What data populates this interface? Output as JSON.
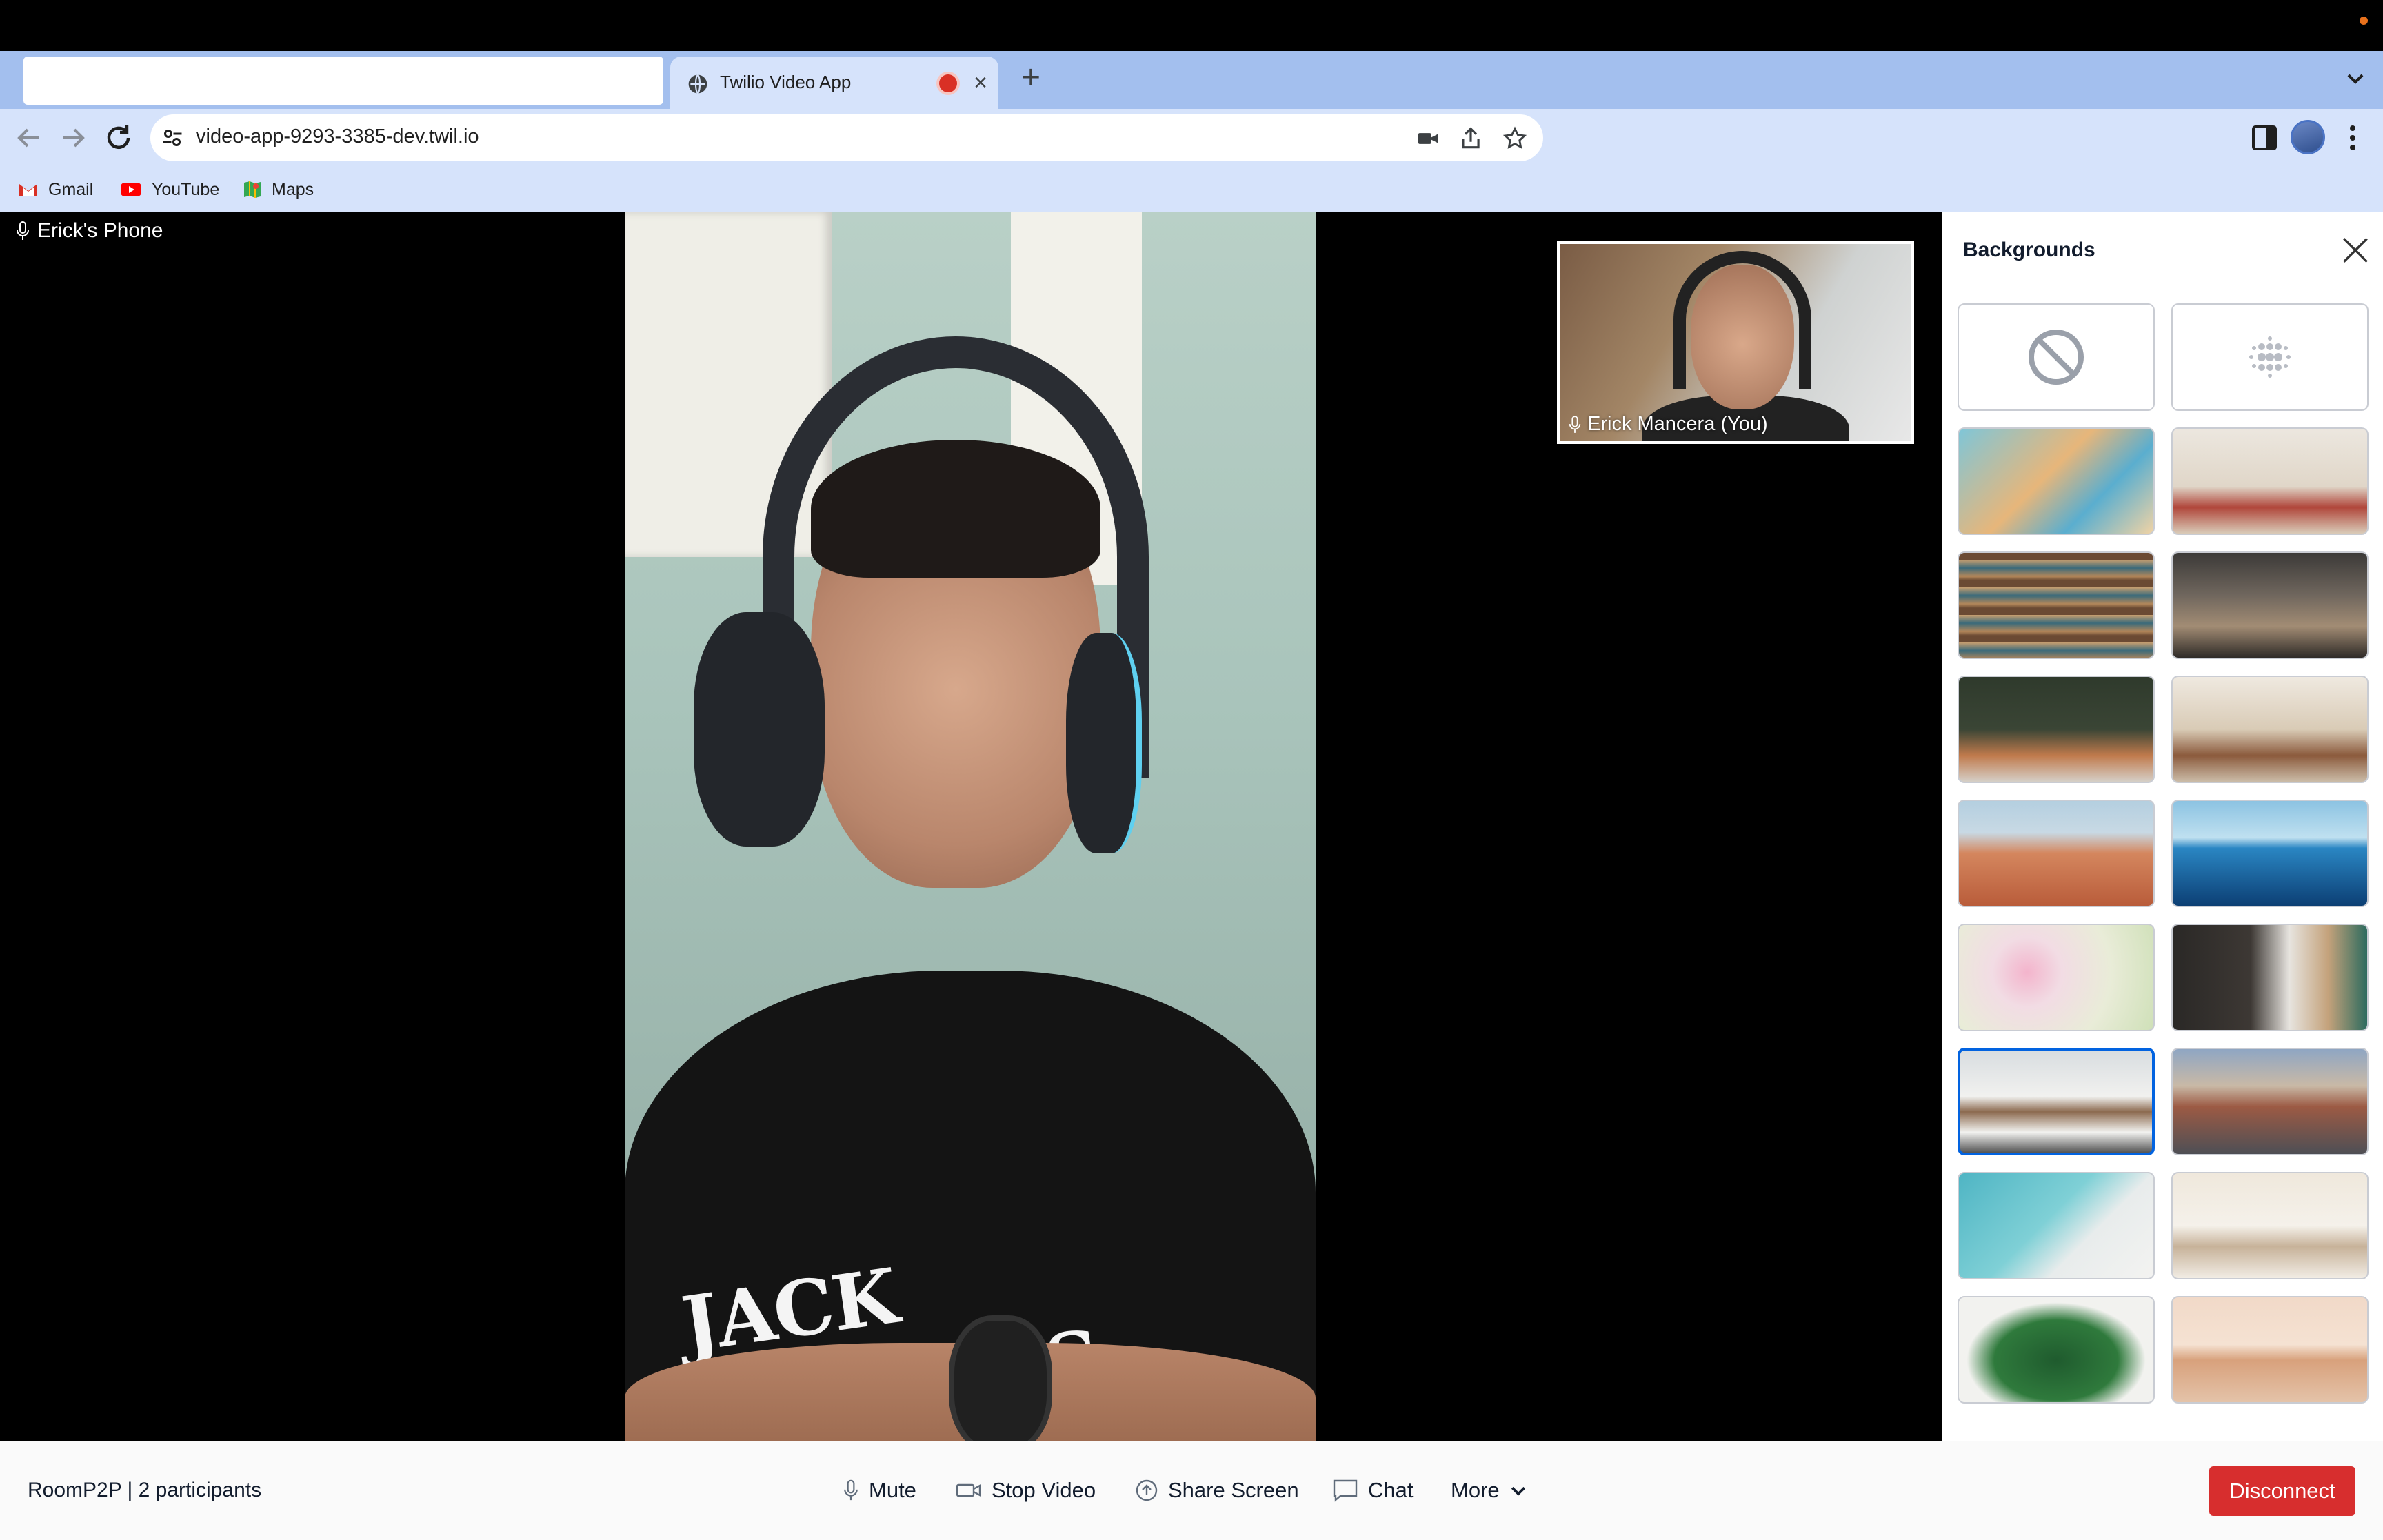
{
  "browser": {
    "active_tab_title": "Twilio Video App",
    "url": "video-app-9293-3385-dev.twil.io",
    "bookmarks": [
      {
        "label": "Gmail",
        "icon": "gmail-icon"
      },
      {
        "label": "YouTube",
        "icon": "youtube-icon"
      },
      {
        "label": "Maps",
        "icon": "maps-icon"
      }
    ]
  },
  "video": {
    "main_participant_label": "Erick's Phone",
    "self_view_label": "Erick Mancera (You)",
    "shirt_text": "JACK DANIEL'S"
  },
  "backgrounds_panel": {
    "title": "Backgrounds",
    "options": [
      {
        "name": "none",
        "selected": false
      },
      {
        "name": "blur",
        "selected": false
      },
      {
        "name": "abstract-smoke",
        "selected": false
      },
      {
        "name": "living-room",
        "selected": false
      },
      {
        "name": "bookshelf",
        "selected": false
      },
      {
        "name": "coffee-shop",
        "selected": false
      },
      {
        "name": "lounge-dark",
        "selected": false
      },
      {
        "name": "lounge-bright",
        "selected": false
      },
      {
        "name": "desert",
        "selected": false
      },
      {
        "name": "ocean",
        "selected": false
      },
      {
        "name": "flowers",
        "selected": false
      },
      {
        "name": "kitchen",
        "selected": false
      },
      {
        "name": "modern-living-room",
        "selected": true
      },
      {
        "name": "mountains",
        "selected": false
      },
      {
        "name": "beach",
        "selected": false
      },
      {
        "name": "dining-room",
        "selected": false
      },
      {
        "name": "monstera-leaves",
        "selected": false
      },
      {
        "name": "golden-gate-bridge",
        "selected": false
      }
    ]
  },
  "bottom_bar": {
    "room_info": "RoomP2P | 2 participants",
    "mute_label": "Mute",
    "stop_video_label": "Stop Video",
    "share_screen_label": "Share Screen",
    "chat_label": "Chat",
    "more_label": "More",
    "disconnect_label": "Disconnect"
  },
  "colors": {
    "tab_strip": "#a3bfee",
    "toolbar": "#d6e3fb",
    "disconnect": "#d72e2e",
    "selected_border": "#0263e0",
    "recording_dot": "#d93025"
  }
}
